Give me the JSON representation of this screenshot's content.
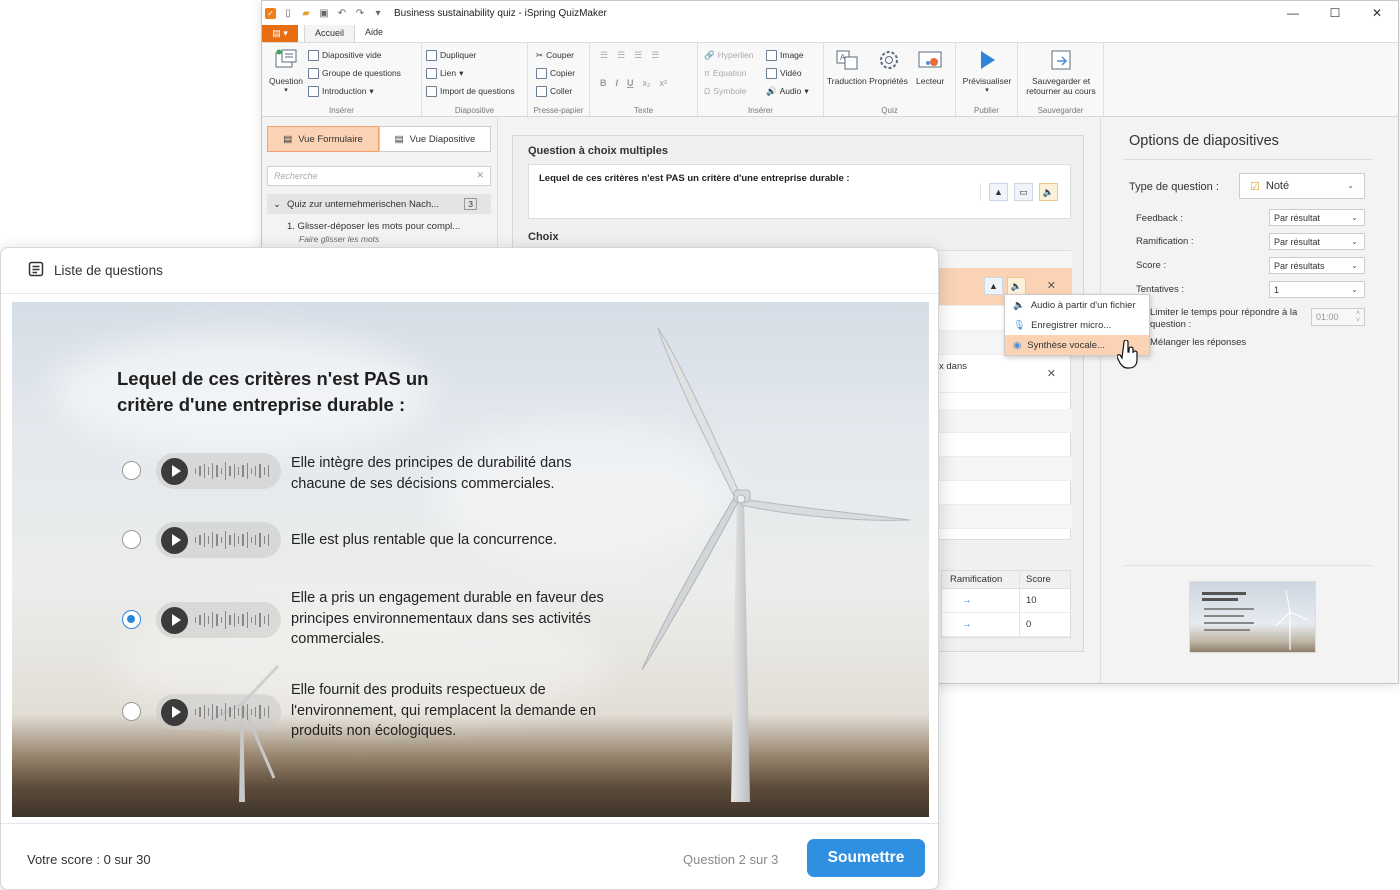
{
  "app": {
    "title": "Business sustainability quiz - iSpring QuizMaker",
    "tabs": [
      "Accueil",
      "Aide"
    ],
    "ribbon": {
      "question_btn": "Question",
      "slide_group": [
        "Diapositive vide",
        "Groupe de questions",
        "Introduction"
      ],
      "insert_label_1": "Insérer",
      "diapo_group": [
        "Dupliquer",
        "Lien",
        "Import de questions"
      ],
      "diapo_label": "Diapositive",
      "clipboard_group": [
        "Couper",
        "Copier",
        "Coller"
      ],
      "clipboard_label": "Presse-papier",
      "text_label": "Texte",
      "insert_group": [
        "Hyperlien",
        "Equation",
        "Symbole"
      ],
      "insert_group_2": [
        "Image",
        "Vidéo",
        "Audio"
      ],
      "insert_label_2": "Insérer",
      "quiz_btns": [
        "Traduction",
        "Propriétés",
        "Lecteur"
      ],
      "quiz_label": "Quiz",
      "preview_btn": "Prévisualiser",
      "publish_label": "Publier",
      "save_btn": "Sauvegarder et retourner au cours",
      "save_label": "Sauvegarder"
    },
    "left": {
      "view_form": "Vue Formulaire",
      "view_slide": "Vue Diapositive",
      "search_placeholder": "Recherche",
      "tree_header": "Quiz zur unternehmerischen Nach...",
      "tree_count": "3",
      "tree_item": "1.  Glisser-déposer les mots pour compl...",
      "tree_item_sub": "Faire glisser les mots"
    },
    "center": {
      "qtype": "Question à choix multiples",
      "question": "Lequel de ces critères n'est PAS un critère d'une entreprise durable :",
      "choix": "Choix",
      "row_partial_text": "x dans",
      "score_headers": [
        "Ramification",
        "Score"
      ],
      "score_rows": [
        {
          "arrow": "→",
          "score": "10"
        },
        {
          "arrow": "→",
          "score": "0"
        }
      ]
    },
    "options": {
      "title": "Options de diapositives",
      "type_label": "Type de question :",
      "type_value": "Noté",
      "feedback_label": "Feedback :",
      "feedback_value": "Par résultat",
      "ramif_label": "Ramification :",
      "ramif_value": "Par résultat",
      "score_label": "Score :",
      "score_value": "Par résultats",
      "attempts_label": "Tentatives :",
      "attempts_value": "1",
      "limit_time_label": "Limiter le temps pour répondre à la question :",
      "time_value": "01:00",
      "shuffle_label": "Mélanger les réponses"
    },
    "context_menu": [
      "Audio à partir d'un fichier",
      "Enregistrer micro...",
      "Synthèse vocale..."
    ]
  },
  "player": {
    "header": "Liste de questions",
    "question": "Lequel de ces critères n'est PAS un critère d'une entreprise durable :",
    "answers": [
      {
        "text": "Elle intègre des principes de durabilité dans chacune de ses décisions commerciales.",
        "selected": false
      },
      {
        "text": "Elle est plus rentable que la concurrence.",
        "selected": false
      },
      {
        "text": "Elle a pris un engagement durable en faveur des principes environnementaux dans ses activités commerciales.",
        "selected": true
      },
      {
        "text": "Elle fournit des produits respectueux de l'environnement, qui remplacent la demande en produits non écologiques.",
        "selected": false
      }
    ],
    "score": "Votre score : 0 sur 30",
    "question_count": "Question 2 sur 3",
    "submit": "Soumettre"
  },
  "colors": {
    "accent_orange": "#e96e12",
    "accent_blue": "#2f8fe0",
    "hover_peach": "#fbd3b4"
  }
}
